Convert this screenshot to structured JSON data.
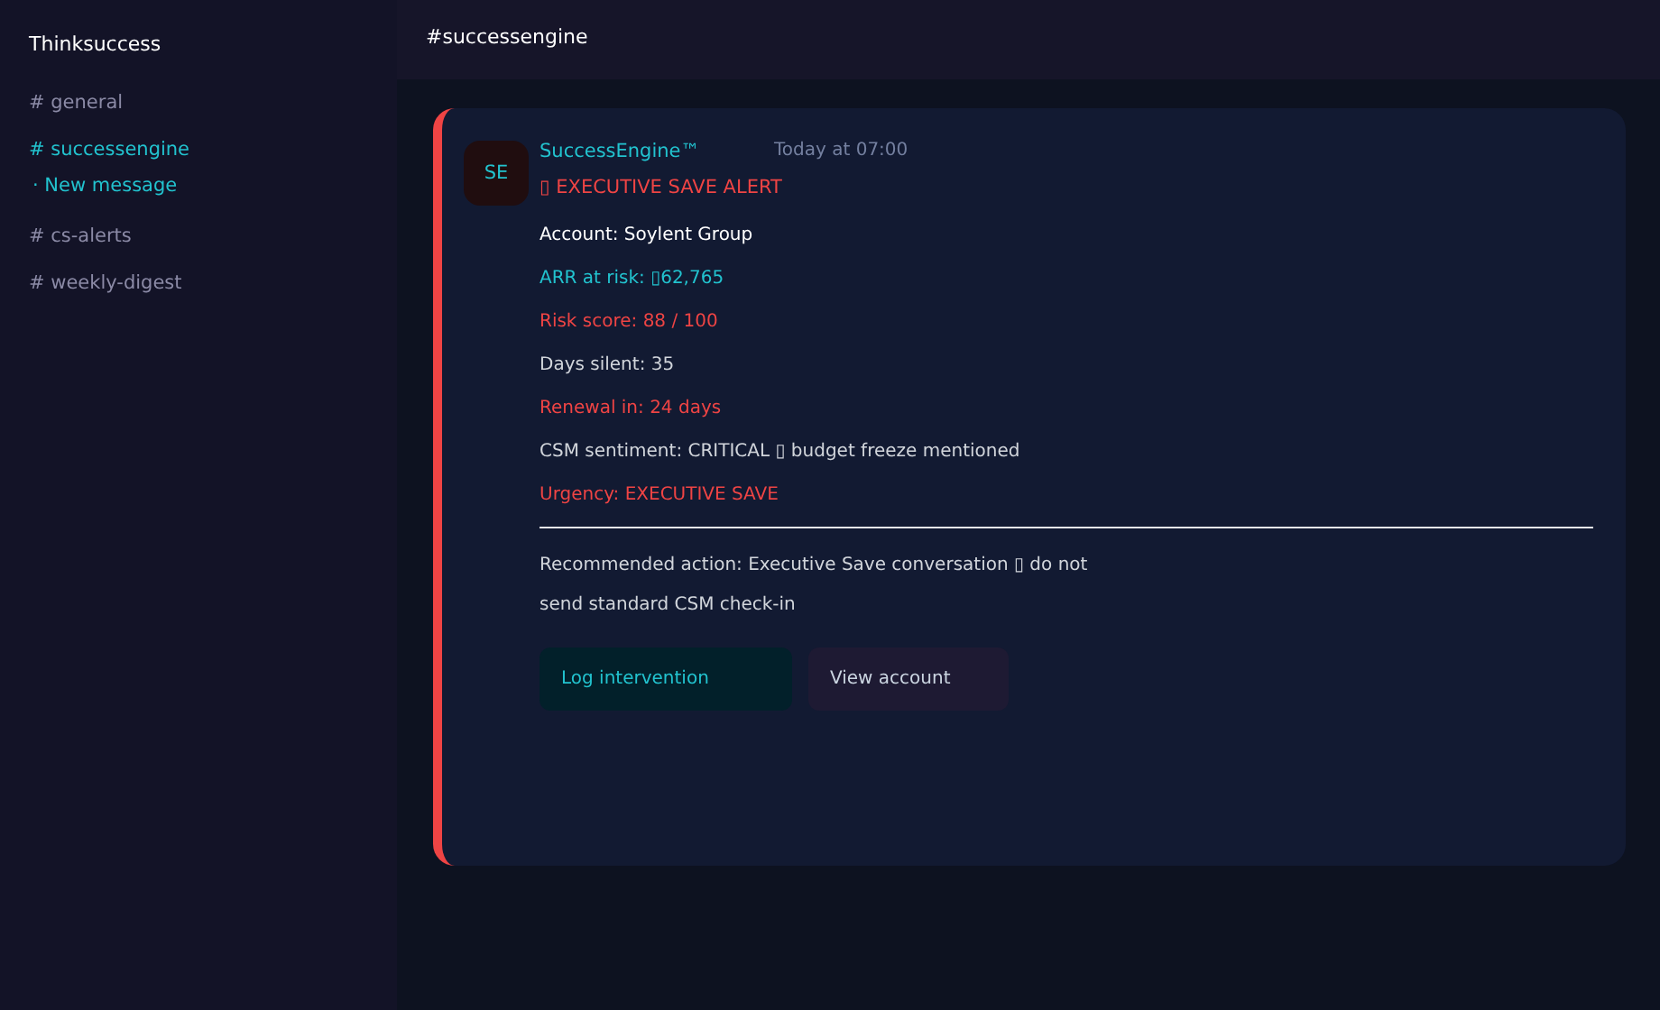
{
  "sidebar": {
    "workspace": "Thinksuccess",
    "channels": [
      {
        "label": "# general",
        "selected": false
      },
      {
        "label": "# successengine",
        "selected": true,
        "note": "· New message"
      },
      {
        "label": "# cs-alerts",
        "selected": false
      },
      {
        "label": "# weekly-digest",
        "selected": false
      }
    ]
  },
  "header": {
    "title": "#successengine"
  },
  "message": {
    "avatar": "SE",
    "sender": "SuccessEngine™",
    "time": "Today at 07:00",
    "alert": "▯ EXECUTIVE SAVE ALERT",
    "fields": [
      {
        "text": "Account:  Soylent Group",
        "color": "#ffffff"
      },
      {
        "text": "ARR at risk:  ▯62,765",
        "color": "#22c3cf"
      },
      {
        "text": "Risk score:  88 / 100",
        "color": "#ef4444"
      },
      {
        "text": "Days silent:  35",
        "color": "#d1d5db"
      },
      {
        "text": "Renewal in:  24 days",
        "color": "#ef4444"
      },
      {
        "text": "CSM sentiment:  CRITICAL ▯ budget freeze mentioned",
        "color": "#d1d5db"
      },
      {
        "text": "Urgency:  EXECUTIVE SAVE",
        "color": "#ef4444"
      }
    ],
    "recommendation": "Recommended action:  Executive Save conversation ▯ do not send standard CSM check-in",
    "buttons": [
      {
        "label": "Log intervention",
        "kind": "primary"
      },
      {
        "label": "View account",
        "kind": "secondary"
      }
    ]
  }
}
